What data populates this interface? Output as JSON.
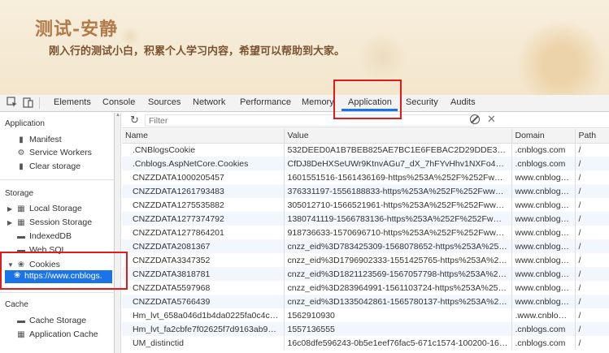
{
  "banner": {
    "title": "测试-安静",
    "subtitle": "刚入行的测试小白，积累个人学习内容，希望可以帮助到大家。"
  },
  "devtools": {
    "tabs": [
      "Elements",
      "Console",
      "Sources",
      "Network",
      "Performance",
      "Memory",
      "Application",
      "Security",
      "Audits"
    ],
    "active_tab": "Application",
    "accent": "#1a73e8",
    "highlight": "#e01b1b"
  },
  "sidebar": {
    "application_heading": "Application",
    "application_items": [
      "Manifest",
      "Service Workers",
      "Clear storage"
    ],
    "storage_heading": "Storage",
    "storage_items": [
      "Local Storage",
      "Session Storage",
      "IndexedDB",
      "Web SQL",
      "Cookies"
    ],
    "cookie_child": "https://www.cnblogs.",
    "cache_heading": "Cache",
    "cache_items": [
      "Cache Storage",
      "Application Cache"
    ]
  },
  "filter": {
    "placeholder": "Filter"
  },
  "table": {
    "headers": [
      "Name",
      "Value",
      "Domain",
      "Path"
    ],
    "rows": [
      [
        ".CNBlogsCookie",
        "532DEED0A1B7BEB825AE7BC1E6FEBAC2D29DDE3B0D8417...",
        ".cnblogs.com",
        "/"
      ],
      [
        ".Cnblogs.AspNetCore.Cookies",
        "CfDJ8DeHXSeUWr9KtnvAGu7_dX_7hFYvHhv1NXFo40mdPF...",
        ".cnblogs.com",
        "/"
      ],
      [
        "CNZZDATA1000205457",
        "1601551516-1561436169-https%253A%252F%252Fwww.ba...",
        "www.cnblogs....",
        "/"
      ],
      [
        "CNZZDATA1261793483",
        "376331197-1556188833-https%253A%252F%252Fwww.bai...",
        "www.cnblogs....",
        "/"
      ],
      [
        "CNZZDATA1275535882",
        "305012710-1566521961-https%253A%252F%252Fwww.cnb...",
        "www.cnblogs....",
        "/"
      ],
      [
        "CNZZDATA1277374792",
        "1380741119-1566783136-https%253A%252F%252Fwww.ba...",
        "www.cnblogs....",
        "/"
      ],
      [
        "CNZZDATA1277864201",
        "918736633-1570696710-https%253A%252F%252Fwww.bai...",
        "www.cnblogs....",
        "/"
      ],
      [
        "CNZZDATA2081367",
        "cnzz_eid%3D783425309-1568078652-https%253A%252F%...",
        "www.cnblogs....",
        "/"
      ],
      [
        "CNZZDATA3347352",
        "cnzz_eid%3D1796902333-1551425765-https%253A%252F...",
        "www.cnblogs....",
        "/"
      ],
      [
        "CNZZDATA3818781",
        "cnzz_eid%3D1821123569-1567057798-https%253A%252F...",
        "www.cnblogs....",
        "/"
      ],
      [
        "CNZZDATA5597968",
        "cnzz_eid%3D283964991-1561103724-https%253A%252F%...",
        "www.cnblogs....",
        "/"
      ],
      [
        "CNZZDATA5766439",
        "cnzz_eid%3D1335042861-1565780137-https%253A%252F...",
        "www.cnblogs....",
        "/"
      ],
      [
        "Hm_lvt_658a046d1b4da0225fa0c4c2cf8...",
        "1562910930",
        ".www.cnblogs....",
        "/"
      ],
      [
        "Hm_lvt_fa2cbfe7f02625f7d9163ab9002...",
        "1557136555",
        ".cnblogs.com",
        "/"
      ],
      [
        "UM_distinctid",
        "16c08dfe596243-0b5e1eef76fac5-671c1574-100200-16c08...",
        ".cnblogs.com",
        "/"
      ]
    ]
  }
}
